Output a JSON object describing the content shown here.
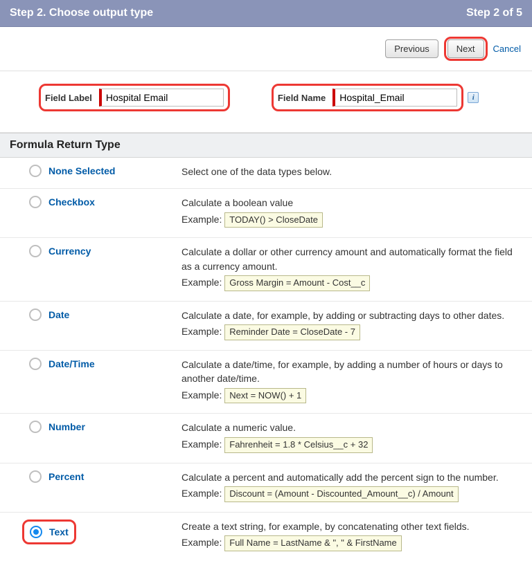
{
  "header": {
    "title": "Step 2. Choose output type",
    "step_indicator": "Step 2 of 5"
  },
  "nav": {
    "previous": "Previous",
    "next": "Next",
    "cancel": "Cancel"
  },
  "fields": {
    "field_label_text": "Field Label",
    "field_label_value": "Hospital Email",
    "field_name_text": "Field Name",
    "field_name_value": "Hospital_Email"
  },
  "section_title": "Formula Return Type",
  "example_prefix": "Example:",
  "types": [
    {
      "name": "None Selected",
      "selected": false,
      "desc": "Select one of the data types below.",
      "example": null
    },
    {
      "name": "Checkbox",
      "selected": false,
      "desc": "Calculate a boolean value",
      "example": "TODAY() > CloseDate"
    },
    {
      "name": "Currency",
      "selected": false,
      "desc": "Calculate a dollar or other currency amount and automatically format the field as a currency amount.",
      "example": "Gross Margin = Amount - Cost__c"
    },
    {
      "name": "Date",
      "selected": false,
      "desc": "Calculate a date, for example, by adding or subtracting days to other dates.",
      "example": "Reminder Date = CloseDate - 7"
    },
    {
      "name": "Date/Time",
      "selected": false,
      "desc": "Calculate a date/time, for example, by adding a number of hours or days to another date/time.",
      "example": "Next = NOW() + 1"
    },
    {
      "name": "Number",
      "selected": false,
      "desc": "Calculate a numeric value.",
      "example": "Fahrenheit = 1.8 * Celsius__c + 32"
    },
    {
      "name": "Percent",
      "selected": false,
      "desc": "Calculate a percent and automatically add the percent sign to the number.",
      "example": "Discount = (Amount - Discounted_Amount__c) / Amount"
    },
    {
      "name": "Text",
      "selected": true,
      "desc": "Create a text string, for example, by concatenating other text fields.",
      "example": "Full Name = LastName & \", \" & FirstName"
    }
  ]
}
